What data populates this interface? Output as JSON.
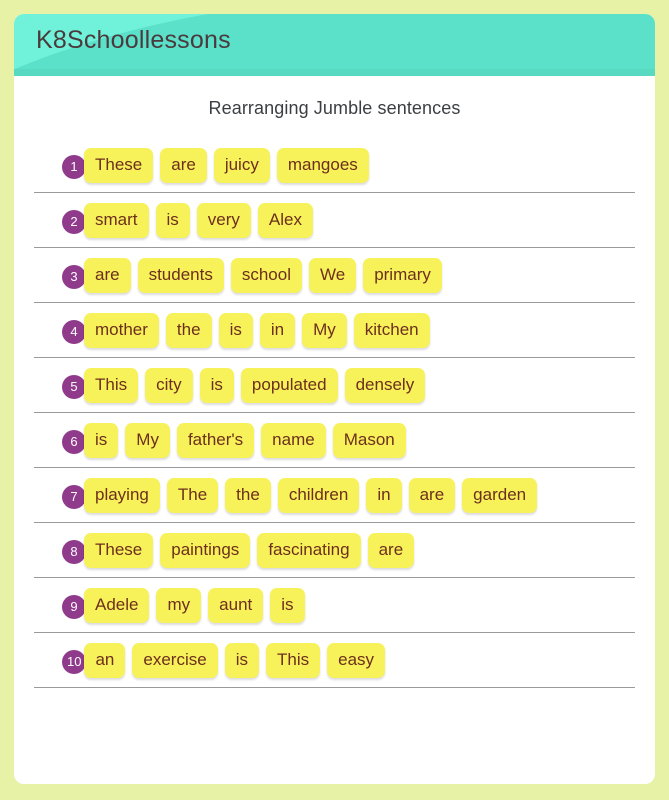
{
  "header": {
    "site_title": "K8Schoollessons",
    "bg_color": "#6ff2d9",
    "title_color": "#4a3a3d"
  },
  "page": {
    "background_color": "#e8f2a6",
    "card_color": "#ffffff",
    "title": "Rearranging Jumble sentences"
  },
  "style": {
    "chip_bg": "#f7f25a",
    "chip_text": "#6d2f1c",
    "badge_bg": "#903a8c",
    "badge_text": "#ffffff",
    "divider": "#9a9a9a"
  },
  "exercises": [
    {
      "number": "1",
      "words": [
        "These",
        "are",
        "juicy",
        "mangoes"
      ]
    },
    {
      "number": "2",
      "words": [
        "smart",
        "is",
        "very",
        "Alex"
      ]
    },
    {
      "number": "3",
      "words": [
        "are",
        "students",
        "school",
        "We",
        "primary"
      ]
    },
    {
      "number": "4",
      "words": [
        "mother",
        "the",
        "is",
        "in",
        "My",
        "kitchen"
      ]
    },
    {
      "number": "5",
      "words": [
        "This",
        "city",
        "is",
        "populated",
        "densely"
      ]
    },
    {
      "number": "6",
      "words": [
        "is",
        "My",
        "father's",
        "name",
        "Mason"
      ]
    },
    {
      "number": "7",
      "words": [
        "playing",
        "The",
        "the",
        "children",
        "in",
        "are",
        "garden"
      ]
    },
    {
      "number": "8",
      "words": [
        "These",
        "paintings",
        "fascinating",
        "are"
      ]
    },
    {
      "number": "9",
      "words": [
        "Adele",
        "my",
        "aunt",
        "is"
      ]
    },
    {
      "number": "10",
      "words": [
        "an",
        "exercise",
        "is",
        "This",
        "easy"
      ]
    }
  ]
}
